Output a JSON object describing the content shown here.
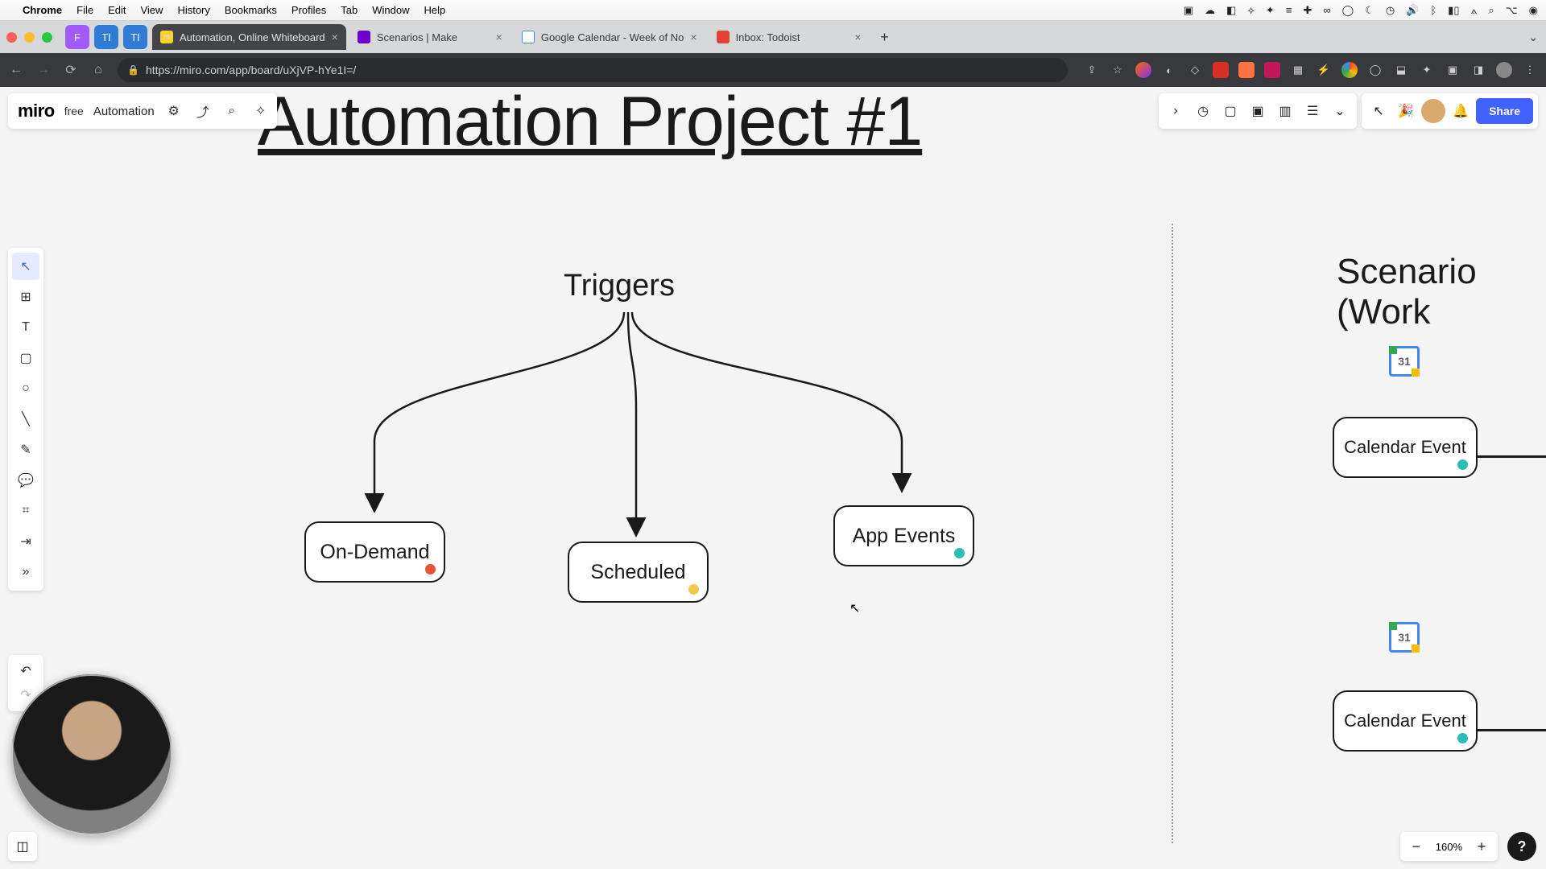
{
  "mac_menu": {
    "app": "Chrome",
    "items": [
      "File",
      "Edit",
      "View",
      "History",
      "Bookmarks",
      "Profiles",
      "Tab",
      "Window",
      "Help"
    ]
  },
  "tabs": [
    {
      "label": "Automation, Online Whiteboard",
      "active": true
    },
    {
      "label": "Scenarios | Make",
      "active": false
    },
    {
      "label": "Google Calendar - Week of No",
      "active": false
    },
    {
      "label": "Inbox: Todoist",
      "active": false
    }
  ],
  "url": "https://miro.com/app/board/uXjVP-hYe1I=/",
  "miro": {
    "logo": "miro",
    "plan": "free",
    "board_name": "Automation",
    "share": "Share"
  },
  "zoom": "160%",
  "canvas": {
    "title": "Automation Project #1",
    "triggers_label": "Triggers",
    "nodes": {
      "ondemand": "On-Demand",
      "scheduled": "Scheduled",
      "appevents": "App Events"
    },
    "section2": "Scenario (Work",
    "cal1": "Calendar Event",
    "cal2": "Calendar Event",
    "cal_day": "31"
  }
}
